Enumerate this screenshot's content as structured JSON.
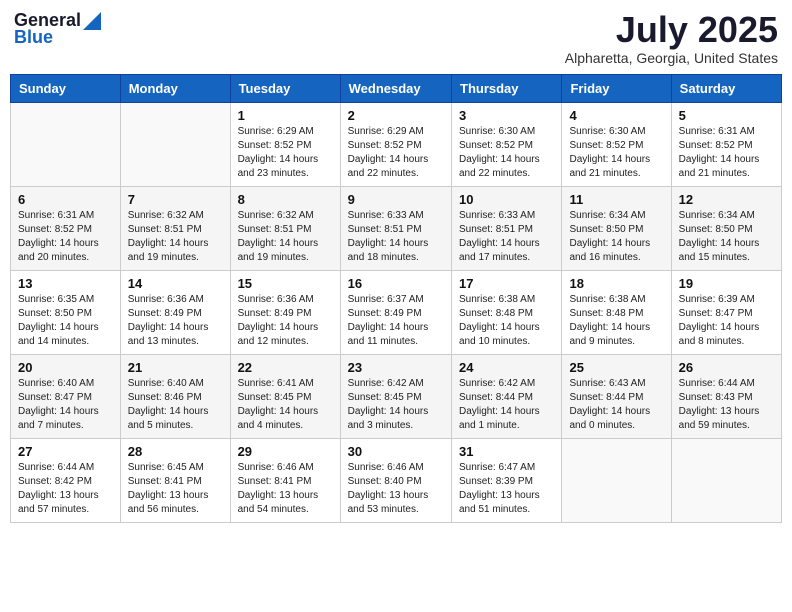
{
  "logo": {
    "general": "General",
    "blue": "Blue"
  },
  "title": "July 2025",
  "location": "Alpharetta, Georgia, United States",
  "weekdays": [
    "Sunday",
    "Monday",
    "Tuesday",
    "Wednesday",
    "Thursday",
    "Friday",
    "Saturday"
  ],
  "weeks": [
    [
      {
        "day": "",
        "sunrise": "",
        "sunset": "",
        "daylight": ""
      },
      {
        "day": "",
        "sunrise": "",
        "sunset": "",
        "daylight": ""
      },
      {
        "day": "1",
        "sunrise": "Sunrise: 6:29 AM",
        "sunset": "Sunset: 8:52 PM",
        "daylight": "Daylight: 14 hours and 23 minutes."
      },
      {
        "day": "2",
        "sunrise": "Sunrise: 6:29 AM",
        "sunset": "Sunset: 8:52 PM",
        "daylight": "Daylight: 14 hours and 22 minutes."
      },
      {
        "day": "3",
        "sunrise": "Sunrise: 6:30 AM",
        "sunset": "Sunset: 8:52 PM",
        "daylight": "Daylight: 14 hours and 22 minutes."
      },
      {
        "day": "4",
        "sunrise": "Sunrise: 6:30 AM",
        "sunset": "Sunset: 8:52 PM",
        "daylight": "Daylight: 14 hours and 21 minutes."
      },
      {
        "day": "5",
        "sunrise": "Sunrise: 6:31 AM",
        "sunset": "Sunset: 8:52 PM",
        "daylight": "Daylight: 14 hours and 21 minutes."
      }
    ],
    [
      {
        "day": "6",
        "sunrise": "Sunrise: 6:31 AM",
        "sunset": "Sunset: 8:52 PM",
        "daylight": "Daylight: 14 hours and 20 minutes."
      },
      {
        "day": "7",
        "sunrise": "Sunrise: 6:32 AM",
        "sunset": "Sunset: 8:51 PM",
        "daylight": "Daylight: 14 hours and 19 minutes."
      },
      {
        "day": "8",
        "sunrise": "Sunrise: 6:32 AM",
        "sunset": "Sunset: 8:51 PM",
        "daylight": "Daylight: 14 hours and 19 minutes."
      },
      {
        "day": "9",
        "sunrise": "Sunrise: 6:33 AM",
        "sunset": "Sunset: 8:51 PM",
        "daylight": "Daylight: 14 hours and 18 minutes."
      },
      {
        "day": "10",
        "sunrise": "Sunrise: 6:33 AM",
        "sunset": "Sunset: 8:51 PM",
        "daylight": "Daylight: 14 hours and 17 minutes."
      },
      {
        "day": "11",
        "sunrise": "Sunrise: 6:34 AM",
        "sunset": "Sunset: 8:50 PM",
        "daylight": "Daylight: 14 hours and 16 minutes."
      },
      {
        "day": "12",
        "sunrise": "Sunrise: 6:34 AM",
        "sunset": "Sunset: 8:50 PM",
        "daylight": "Daylight: 14 hours and 15 minutes."
      }
    ],
    [
      {
        "day": "13",
        "sunrise": "Sunrise: 6:35 AM",
        "sunset": "Sunset: 8:50 PM",
        "daylight": "Daylight: 14 hours and 14 minutes."
      },
      {
        "day": "14",
        "sunrise": "Sunrise: 6:36 AM",
        "sunset": "Sunset: 8:49 PM",
        "daylight": "Daylight: 14 hours and 13 minutes."
      },
      {
        "day": "15",
        "sunrise": "Sunrise: 6:36 AM",
        "sunset": "Sunset: 8:49 PM",
        "daylight": "Daylight: 14 hours and 12 minutes."
      },
      {
        "day": "16",
        "sunrise": "Sunrise: 6:37 AM",
        "sunset": "Sunset: 8:49 PM",
        "daylight": "Daylight: 14 hours and 11 minutes."
      },
      {
        "day": "17",
        "sunrise": "Sunrise: 6:38 AM",
        "sunset": "Sunset: 8:48 PM",
        "daylight": "Daylight: 14 hours and 10 minutes."
      },
      {
        "day": "18",
        "sunrise": "Sunrise: 6:38 AM",
        "sunset": "Sunset: 8:48 PM",
        "daylight": "Daylight: 14 hours and 9 minutes."
      },
      {
        "day": "19",
        "sunrise": "Sunrise: 6:39 AM",
        "sunset": "Sunset: 8:47 PM",
        "daylight": "Daylight: 14 hours and 8 minutes."
      }
    ],
    [
      {
        "day": "20",
        "sunrise": "Sunrise: 6:40 AM",
        "sunset": "Sunset: 8:47 PM",
        "daylight": "Daylight: 14 hours and 7 minutes."
      },
      {
        "day": "21",
        "sunrise": "Sunrise: 6:40 AM",
        "sunset": "Sunset: 8:46 PM",
        "daylight": "Daylight: 14 hours and 5 minutes."
      },
      {
        "day": "22",
        "sunrise": "Sunrise: 6:41 AM",
        "sunset": "Sunset: 8:45 PM",
        "daylight": "Daylight: 14 hours and 4 minutes."
      },
      {
        "day": "23",
        "sunrise": "Sunrise: 6:42 AM",
        "sunset": "Sunset: 8:45 PM",
        "daylight": "Daylight: 14 hours and 3 minutes."
      },
      {
        "day": "24",
        "sunrise": "Sunrise: 6:42 AM",
        "sunset": "Sunset: 8:44 PM",
        "daylight": "Daylight: 14 hours and 1 minute."
      },
      {
        "day": "25",
        "sunrise": "Sunrise: 6:43 AM",
        "sunset": "Sunset: 8:44 PM",
        "daylight": "Daylight: 14 hours and 0 minutes."
      },
      {
        "day": "26",
        "sunrise": "Sunrise: 6:44 AM",
        "sunset": "Sunset: 8:43 PM",
        "daylight": "Daylight: 13 hours and 59 minutes."
      }
    ],
    [
      {
        "day": "27",
        "sunrise": "Sunrise: 6:44 AM",
        "sunset": "Sunset: 8:42 PM",
        "daylight": "Daylight: 13 hours and 57 minutes."
      },
      {
        "day": "28",
        "sunrise": "Sunrise: 6:45 AM",
        "sunset": "Sunset: 8:41 PM",
        "daylight": "Daylight: 13 hours and 56 minutes."
      },
      {
        "day": "29",
        "sunrise": "Sunrise: 6:46 AM",
        "sunset": "Sunset: 8:41 PM",
        "daylight": "Daylight: 13 hours and 54 minutes."
      },
      {
        "day": "30",
        "sunrise": "Sunrise: 6:46 AM",
        "sunset": "Sunset: 8:40 PM",
        "daylight": "Daylight: 13 hours and 53 minutes."
      },
      {
        "day": "31",
        "sunrise": "Sunrise: 6:47 AM",
        "sunset": "Sunset: 8:39 PM",
        "daylight": "Daylight: 13 hours and 51 minutes."
      },
      {
        "day": "",
        "sunrise": "",
        "sunset": "",
        "daylight": ""
      },
      {
        "day": "",
        "sunrise": "",
        "sunset": "",
        "daylight": ""
      }
    ]
  ]
}
